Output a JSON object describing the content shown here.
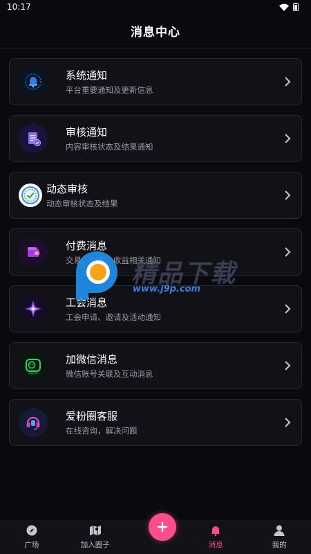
{
  "status": {
    "time": "10:17"
  },
  "header": {
    "title": "消息中心"
  },
  "items": [
    {
      "key": "system",
      "title": "系统通知",
      "sub": "平台重要通知及更新信息",
      "icon": "bell-icon"
    },
    {
      "key": "review",
      "title": "审核通知",
      "sub": "内容审核状态及结果通知",
      "icon": "document-check-icon"
    },
    {
      "key": "moments",
      "title": "动态审核",
      "sub": "动态审核状态及结果",
      "icon": "checkmark-badge-icon"
    },
    {
      "key": "paid",
      "title": "付费消息",
      "sub": "交易、付款、收益相关通知",
      "icon": "wallet-icon"
    },
    {
      "key": "guild",
      "title": "工会消息",
      "sub": "工会申请、邀请及活动通知",
      "icon": "crystal-icon"
    },
    {
      "key": "wechat",
      "title": "加微信消息",
      "sub": "微信账号关联及互动消息",
      "icon": "wechat-icon"
    },
    {
      "key": "service",
      "title": "爱粉圈客服",
      "sub": "在线咨询，解决问题",
      "icon": "headset-icon"
    }
  ],
  "watermark": {
    "text": "精品下载",
    "url": "www.j9p.com"
  },
  "nav": {
    "items": [
      {
        "label": "广场",
        "icon": "compass-icon"
      },
      {
        "label": "加入圈子",
        "icon": "map-icon"
      },
      {
        "label": "消息",
        "icon": "bell-icon",
        "active": true
      },
      {
        "label": "我的",
        "icon": "person-icon"
      }
    ],
    "fab_label": "+"
  },
  "colors": {
    "accent": "#ff4d8a",
    "background": "#0a090f",
    "card": "#121118"
  }
}
